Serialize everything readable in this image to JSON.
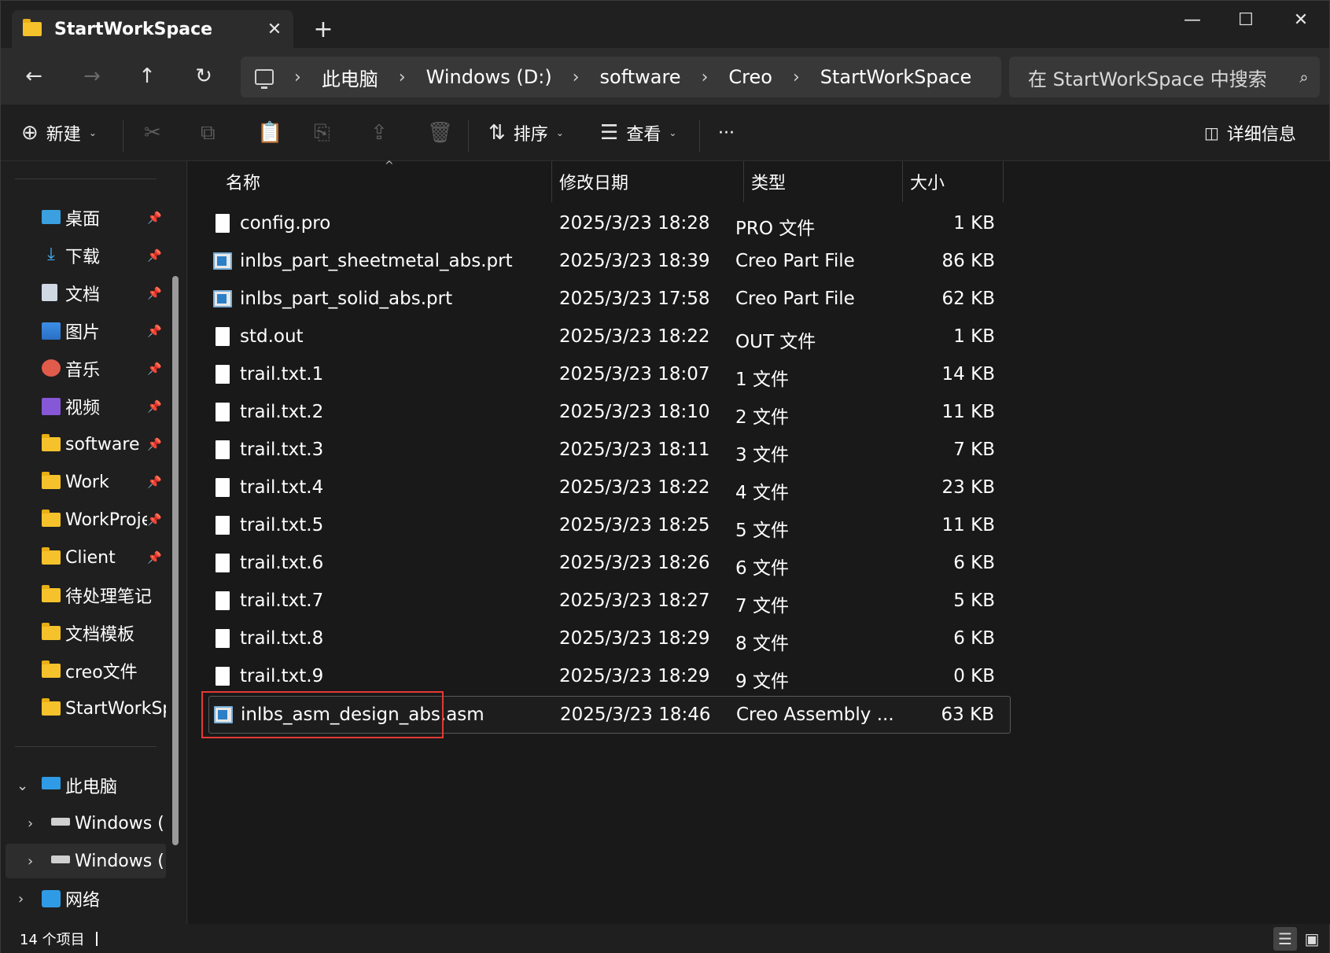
{
  "window": {
    "tab_title": "StartWorkSpace",
    "tab_close": "✕",
    "new_tab": "+",
    "minimize": "—",
    "maximize": "☐",
    "close": "✕"
  },
  "nav": {
    "back": "←",
    "forward": "→",
    "up": "↑",
    "refresh": "↻",
    "breadcrumb": [
      "此电脑",
      "Windows (D:)",
      "software",
      "Creo",
      "StartWorkSpace"
    ],
    "separator": "›",
    "search_placeholder": "在 StartWorkSpace 中搜索",
    "search_icon": "⌕"
  },
  "toolbar": {
    "new_label": "新建",
    "sort_label": "排序",
    "view_label": "查看",
    "more_label": "···",
    "details_label": "详细信息",
    "icons": [
      "cut-icon",
      "copy-icon",
      "paste-icon",
      "rename-icon",
      "share-icon",
      "delete-icon"
    ]
  },
  "sidebar": {
    "quick_access": [
      {
        "label": "桌面",
        "icon": "desktop-icon",
        "pinned": true
      },
      {
        "label": "下载",
        "icon": "download-icon",
        "pinned": true
      },
      {
        "label": "文档",
        "icon": "documents-icon",
        "pinned": true
      },
      {
        "label": "图片",
        "icon": "pictures-icon",
        "pinned": true
      },
      {
        "label": "音乐",
        "icon": "music-icon",
        "pinned": true
      },
      {
        "label": "视频",
        "icon": "videos-icon",
        "pinned": true
      },
      {
        "label": "software",
        "icon": "folder-icon",
        "pinned": true
      },
      {
        "label": "Work",
        "icon": "folder-icon",
        "pinned": true
      },
      {
        "label": "WorkProje",
        "icon": "folder-icon",
        "pinned": true
      },
      {
        "label": "Client",
        "icon": "folder-icon",
        "pinned": true
      },
      {
        "label": "待处理笔记",
        "icon": "folder-icon",
        "pinned": false
      },
      {
        "label": "文档模板",
        "icon": "folder-icon",
        "pinned": false
      },
      {
        "label": "creo文件",
        "icon": "folder-icon",
        "pinned": false
      },
      {
        "label": "StartWorkSp",
        "icon": "folder-icon",
        "pinned": false
      }
    ],
    "this_pc": "此电脑",
    "drives": [
      "Windows (",
      "Windows (I"
    ],
    "network": "网络",
    "pin_glyph": "📌"
  },
  "columns": {
    "name": "名称",
    "modified": "修改日期",
    "type": "类型",
    "size": "大小",
    "sort_arrow": "^"
  },
  "files": [
    {
      "name": "config.pro",
      "date": "2025/3/23 18:28",
      "type": "PRO 文件",
      "size": "1 KB",
      "icon": "file-icon"
    },
    {
      "name": "inlbs_part_sheetmetal_abs.prt",
      "date": "2025/3/23 18:39",
      "type": "Creo Part File",
      "size": "86 KB",
      "icon": "creo-part-icon"
    },
    {
      "name": "inlbs_part_solid_abs.prt",
      "date": "2025/3/23 17:58",
      "type": "Creo Part File",
      "size": "62 KB",
      "icon": "creo-part-icon"
    },
    {
      "name": "std.out",
      "date": "2025/3/23 18:22",
      "type": "OUT 文件",
      "size": "1 KB",
      "icon": "file-icon"
    },
    {
      "name": "trail.txt.1",
      "date": "2025/3/23 18:07",
      "type": "1 文件",
      "size": "14 KB",
      "icon": "file-icon"
    },
    {
      "name": "trail.txt.2",
      "date": "2025/3/23 18:10",
      "type": "2 文件",
      "size": "11 KB",
      "icon": "file-icon"
    },
    {
      "name": "trail.txt.3",
      "date": "2025/3/23 18:11",
      "type": "3 文件",
      "size": "7 KB",
      "icon": "file-icon"
    },
    {
      "name": "trail.txt.4",
      "date": "2025/3/23 18:22",
      "type": "4 文件",
      "size": "23 KB",
      "icon": "file-icon"
    },
    {
      "name": "trail.txt.5",
      "date": "2025/3/23 18:25",
      "type": "5 文件",
      "size": "11 KB",
      "icon": "file-icon"
    },
    {
      "name": "trail.txt.6",
      "date": "2025/3/23 18:26",
      "type": "6 文件",
      "size": "6 KB",
      "icon": "file-icon"
    },
    {
      "name": "trail.txt.7",
      "date": "2025/3/23 18:27",
      "type": "7 文件",
      "size": "5 KB",
      "icon": "file-icon"
    },
    {
      "name": "trail.txt.8",
      "date": "2025/3/23 18:29",
      "type": "8 文件",
      "size": "6 KB",
      "icon": "file-icon"
    },
    {
      "name": "trail.txt.9",
      "date": "2025/3/23 18:29",
      "type": "9 文件",
      "size": "0 KB",
      "icon": "file-icon"
    },
    {
      "name": "inlbs_asm_design_abs.asm",
      "date": "2025/3/23 18:46",
      "type": "Creo Assembly ...",
      "size": "63 KB",
      "icon": "creo-assembly-icon",
      "selected": true
    }
  ],
  "status": {
    "count": "14 个项目"
  },
  "colors": {
    "highlight": "#e53935",
    "folder": "#f6c22b"
  }
}
